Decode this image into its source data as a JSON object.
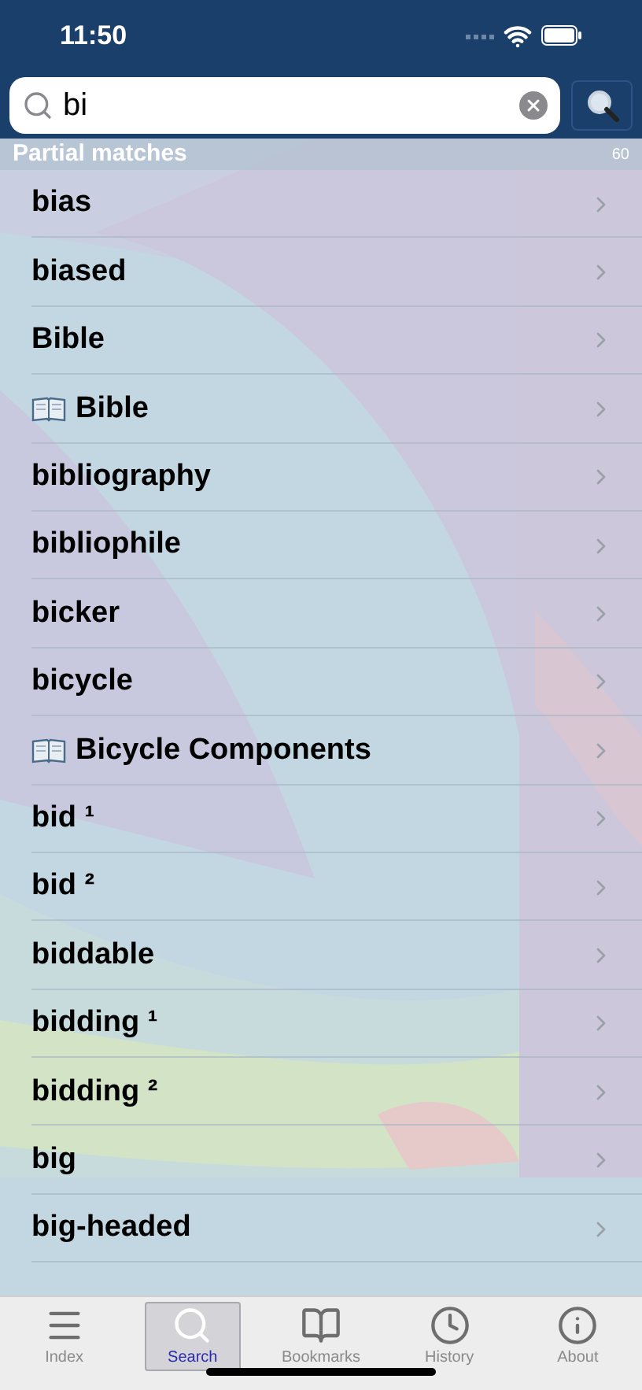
{
  "status_bar": {
    "time": "11:50"
  },
  "search": {
    "value": "bi"
  },
  "section": {
    "title": "Partial matches",
    "count": "60"
  },
  "results": [
    {
      "label": "bias",
      "kind": "word"
    },
    {
      "label": "biased",
      "kind": "word"
    },
    {
      "label": "Bible",
      "kind": "word"
    },
    {
      "label": "Bible",
      "kind": "topic"
    },
    {
      "label": "bibliography",
      "kind": "word"
    },
    {
      "label": "bibliophile",
      "kind": "word"
    },
    {
      "label": "bicker",
      "kind": "word"
    },
    {
      "label": "bicycle",
      "kind": "word"
    },
    {
      "label": "Bicycle Components",
      "kind": "topic"
    },
    {
      "label": "bid ¹",
      "kind": "word"
    },
    {
      "label": "bid ²",
      "kind": "word"
    },
    {
      "label": "biddable",
      "kind": "word"
    },
    {
      "label": "bidding ¹",
      "kind": "word"
    },
    {
      "label": "bidding ²",
      "kind": "word"
    },
    {
      "label": "big",
      "kind": "word"
    },
    {
      "label": "big-headed",
      "kind": "word"
    }
  ],
  "tabs": [
    {
      "label": "Index",
      "kind": "menu",
      "selected": false
    },
    {
      "label": "Search",
      "kind": "search",
      "selected": true
    },
    {
      "label": "Bookmarks",
      "kind": "book",
      "selected": false
    },
    {
      "label": "History",
      "kind": "clock",
      "selected": false
    },
    {
      "label": "About",
      "kind": "info",
      "selected": false
    }
  ]
}
